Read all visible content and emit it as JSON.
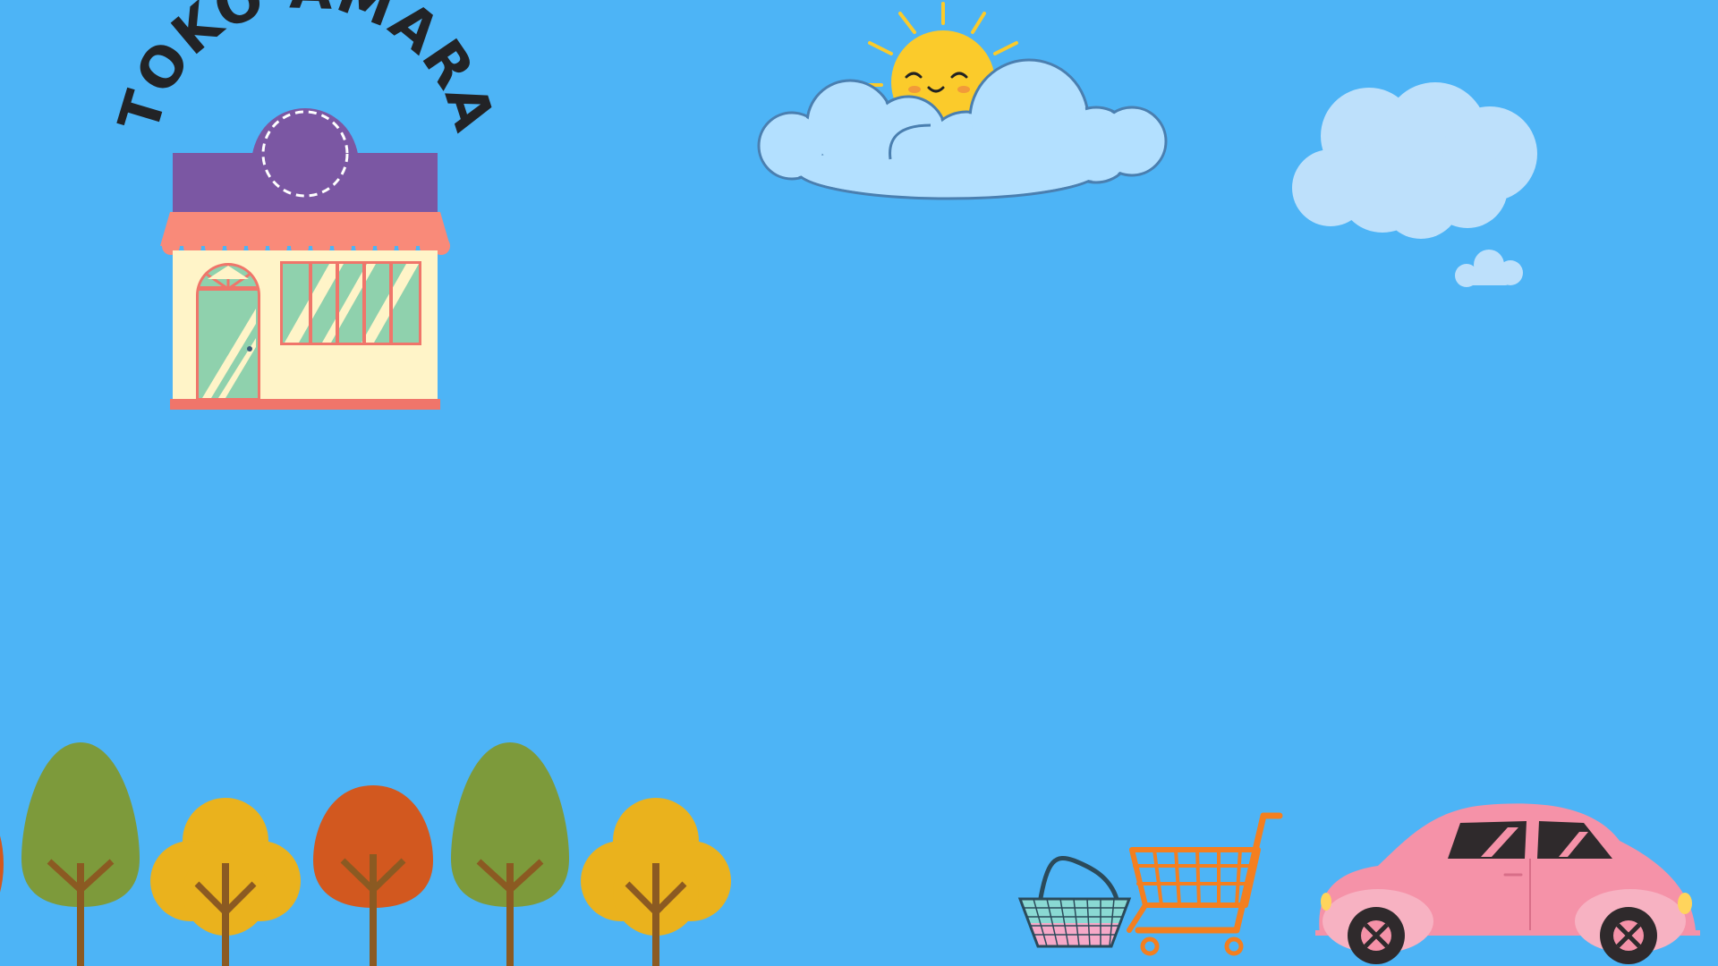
{
  "shop": {
    "name": "TOKO AMARA"
  },
  "icons": {
    "sun": "sun-icon",
    "cloud": "cloud-icon",
    "tree": "tree-icon",
    "basket": "shopping-basket-icon",
    "cart": "shopping-cart-icon",
    "car": "car-icon",
    "store": "store-icon"
  },
  "colors": {
    "sky": "#4db4f6",
    "store_roof": "#7b57a3",
    "awning": "#f98a79",
    "store_wall": "#fff4c8",
    "glass": "#8fd1ad",
    "sun": "#fbcb2b",
    "cloud_light": "#b3e0ff",
    "cloud_pale": "#bde0fb",
    "tree_green": "#7d9a3b",
    "tree_yellow": "#eab21d",
    "tree_orange": "#d2581f",
    "trunk": "#8b5a22",
    "cart": "#f47f1f",
    "car": "#f592a8"
  }
}
